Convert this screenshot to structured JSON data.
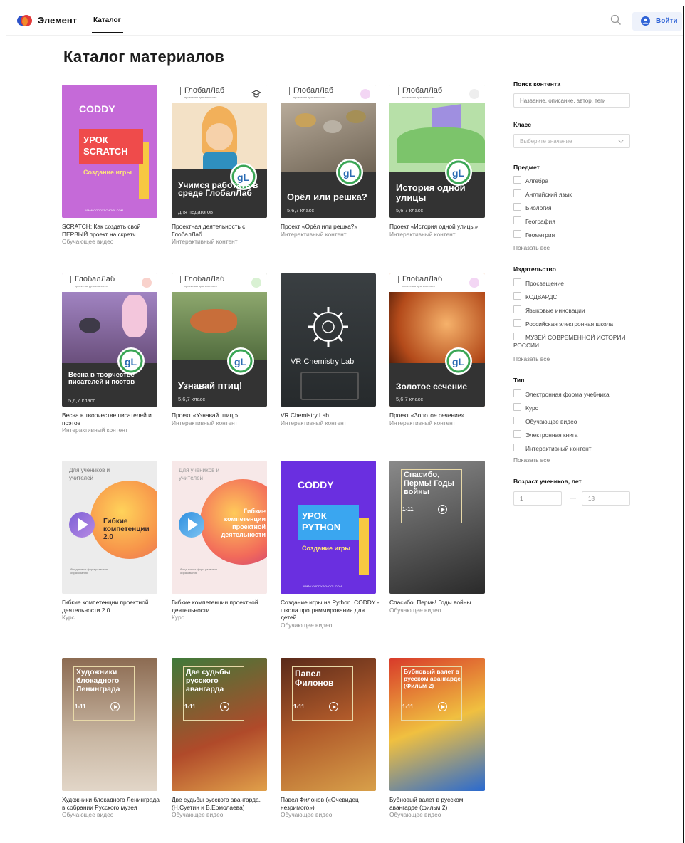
{
  "header": {
    "brand": "Элемент",
    "nav_tab": "Каталог",
    "login_label": "Войти",
    "accent": "#2f63d6"
  },
  "page_title": "Каталог материалов",
  "cards": [
    {
      "title": "SCRATCH: Как создать свой ПЕРВЫЙ проект на скретч",
      "type": "Обучающее видео",
      "thumb": {
        "brand": "CODDY",
        "line1": "УРОК",
        "line2": "SCRATCH",
        "sub": "Создание игры",
        "site": "WWW.CODDYSCHOOL.COM"
      }
    },
    {
      "title": "Проектная деятельность с ГлобалЛаб",
      "type": "Интерактивный контент",
      "thumb": {
        "head": "ГлобалЛаб",
        "head_sub": "проектная деятельность",
        "big": "Учимся работать в среде ГлобалЛаб",
        "sub": "для педагогов"
      }
    },
    {
      "title": "Проект «Орёл или решка?»",
      "type": "Интерактивный контент",
      "thumb": {
        "head": "ГлобалЛаб",
        "head_sub": "проектная деятельность",
        "big": "Орёл или решка?",
        "sub": "5,6,7 класс"
      }
    },
    {
      "title": "Проект «История одной улицы»",
      "type": "Интерактивный контент",
      "thumb": {
        "head": "ГлобалЛаб",
        "head_sub": "проектная деятельность",
        "big": "История одной улицы",
        "sub": "5,6,7 класс"
      }
    },
    {
      "title": "Весна в творчестве писателей и поэтов",
      "type": "Интерактивный контент",
      "thumb": {
        "head": "ГлобалЛаб",
        "head_sub": "проектная деятельность",
        "big": "Весна в творчестве писателей и поэтов",
        "sub": "5,6,7 класс"
      }
    },
    {
      "title": "Проект «Узнавай птиц!»",
      "type": "Интерактивный контент",
      "thumb": {
        "head": "ГлобалЛаб",
        "head_sub": "проектная деятельность",
        "big": "Узнавай птиц!",
        "sub": "5,6,7 класс"
      }
    },
    {
      "title": "VR Chemistry Lab",
      "type": "Интерактивный контент",
      "thumb": {
        "big": "VR Chemistry Lab"
      }
    },
    {
      "title": "Проект «Золотое сечение»",
      "type": "Интерактивный контент",
      "thumb": {
        "head": "ГлобалЛаб",
        "head_sub": "проектная деятельность",
        "big": "Золотое сечение",
        "sub": "5,6,7 класс"
      }
    },
    {
      "title": "Гибкие компетенции проектной деятельности 2.0",
      "type": "Курс",
      "thumb": {
        "top": "Для учеников и учителей",
        "big": "Гибкие компетенции 2.0",
        "foot": "Фонд новых форм развития образования"
      }
    },
    {
      "title": "Гибкие компетенции проектной деятельности",
      "type": "Курс",
      "thumb": {
        "top": "Для учеников и учителей",
        "big": "Гибкие компетенции проектной деятельности",
        "foot": "Фонд новых форм развития образования"
      }
    },
    {
      "title": "Создание игры на Python. CODDY - школа программирования для детей",
      "type": "Обучающее видео",
      "thumb": {
        "brand": "CODDY",
        "line1": "УРОК",
        "line2": "PYTHON",
        "sub": "Создание игры",
        "site": "WWW.CODDYSCHOOL.COM"
      }
    },
    {
      "title": "Спасибо, Пермь! Годы войны",
      "type": "Обучающее видео",
      "thumb": {
        "big": "Спасибо, Пермь! Годы войны",
        "age": "1-11"
      }
    },
    {
      "title": "Художники блокадного Ленинграда в собрании Русского музея",
      "type": "Обучающее видео",
      "thumb": {
        "big": "Художники блокадного Ленинграда",
        "age": "1-11"
      }
    },
    {
      "title": "Две судьбы русского авангарда. (Н.Суетин и В.Ермолаева)",
      "type": "Обучающее видео",
      "thumb": {
        "big": "Две судьбы русского авангарда",
        "age": "1-11"
      }
    },
    {
      "title": "Павел Филонов («Очевидец незримого»)",
      "type": "Обучающее видео",
      "thumb": {
        "big": "Павел Филонов",
        "age": "1-11"
      }
    },
    {
      "title": "Бубновый валет в русском авангарде (фильм 2)",
      "type": "Обучающее видео",
      "thumb": {
        "big": "Бубновый валет в русском авангарде (Фильм 2)",
        "age": "1-11"
      }
    }
  ],
  "filters": {
    "search_label": "Поиск контента",
    "search_placeholder": "Название, описание, автор, теги",
    "class_label": "Класс",
    "class_placeholder": "Выберите значение",
    "subject_label": "Предмет",
    "subjects": [
      "Алгебра",
      "Английский язык",
      "Биология",
      "География",
      "Геометрия"
    ],
    "publisher_label": "Издательство",
    "publishers": [
      "Просвещение",
      "КОДВАРДС",
      "Языковые инновации",
      "Российская электронная школа",
      "МУЗЕЙ СОВРЕМЕННОЙ ИСТОРИИ",
      "РОССИИ"
    ],
    "type_label": "Тип",
    "types": [
      "Электронная форма учебника",
      "Курс",
      "Обучающее видео",
      "Электронная книга",
      "Интерактивный контент"
    ],
    "show_all": "Показать все",
    "age_label": "Возраст учеников, лет",
    "age_from": "1",
    "age_dash": "—",
    "age_to": "18"
  }
}
